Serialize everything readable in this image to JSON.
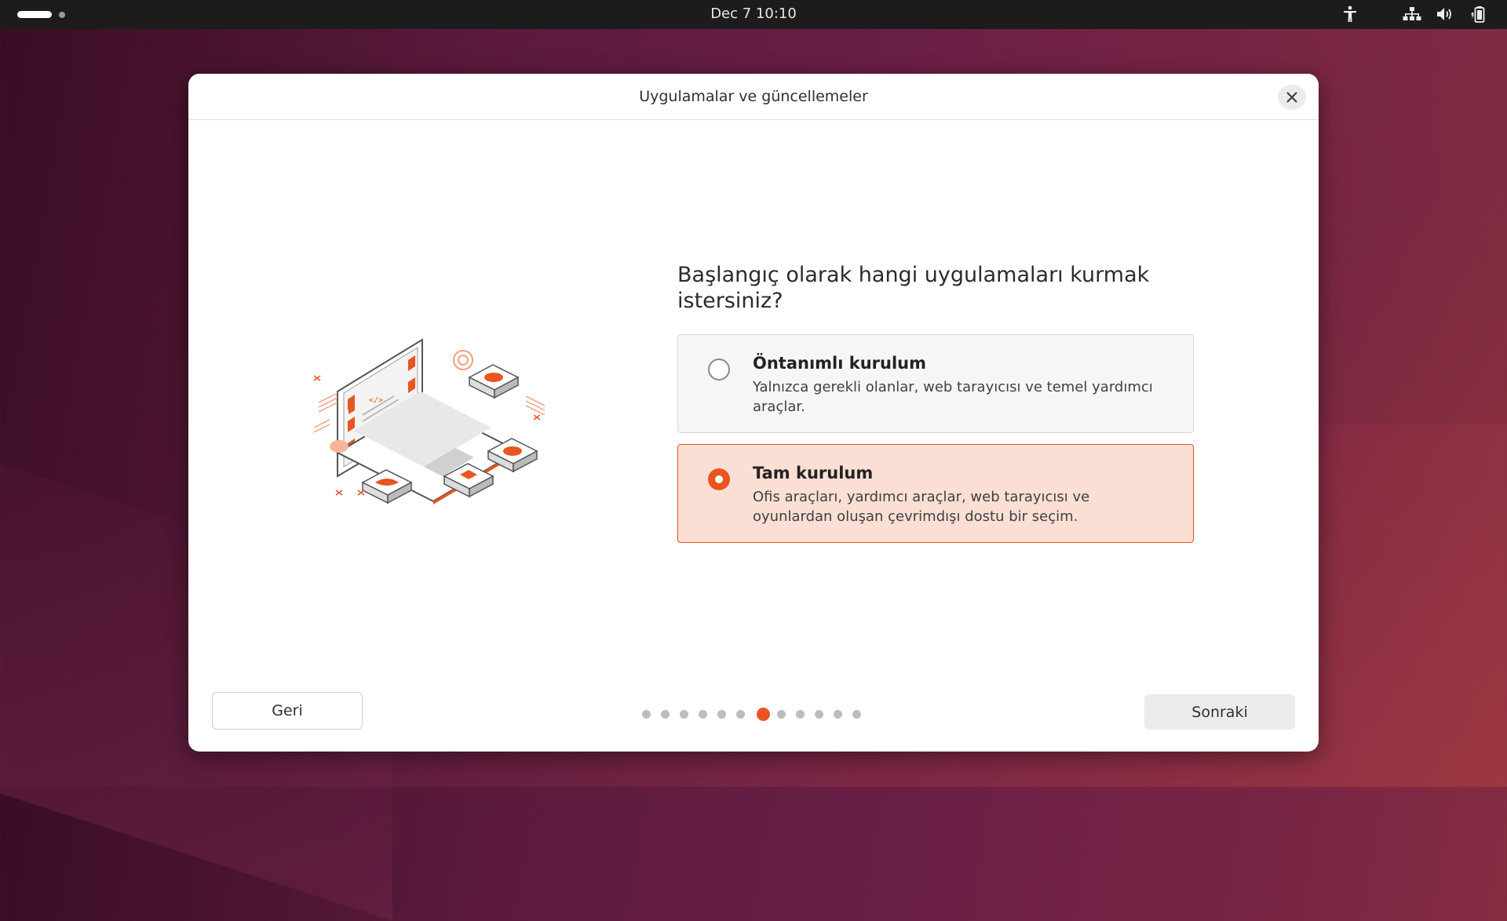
{
  "topbar": {
    "clock": "Dec 7  10:10",
    "icons": [
      "workspace-indicator",
      "accessibility-icon",
      "network-icon",
      "volume-icon",
      "battery-icon"
    ]
  },
  "dialog": {
    "title": "Uygulamalar ve güncellemeler",
    "question": "Başlangıç olarak hangi uygulamaları kurmak istersiniz?",
    "options": [
      {
        "title": "Öntanımlı kurulum",
        "description": "Yalnızca gerekli olanlar, web tarayıcısı ve temel yardımcı araçlar.",
        "selected": false
      },
      {
        "title": "Tam kurulum",
        "description": "Ofis araçları, yardımcı araçlar, web tarayıcısı ve oyunlardan oluşan çevrimdışı dostu bir seçim.",
        "selected": true
      }
    ],
    "back_label": "Geri",
    "next_label": "Sonraki",
    "progress": {
      "total_steps": 12,
      "current_step": 7
    }
  },
  "colors": {
    "accent": "#e95420",
    "selected_bg": "#fbdfd4",
    "topbar_bg": "#1c1c1c"
  }
}
